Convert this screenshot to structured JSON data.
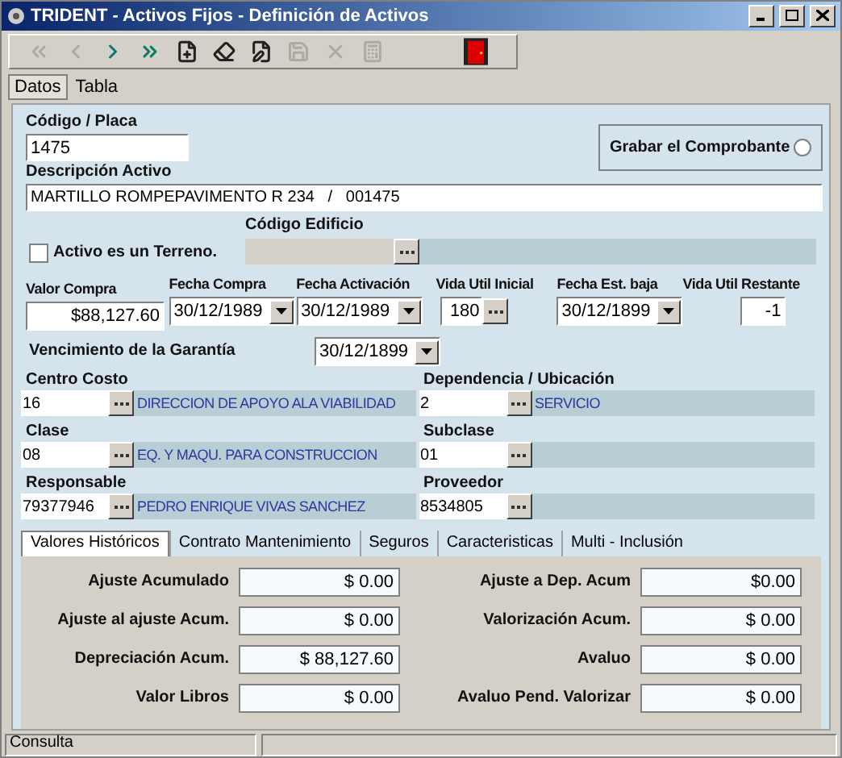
{
  "window": {
    "title": "TRIDENT - Activos Fijos - Definición de Activos"
  },
  "toolbar": [
    {
      "kind": "first",
      "disabled": true
    },
    {
      "kind": "previous",
      "disabled": true
    },
    {
      "kind": "next",
      "disabled": false
    },
    {
      "kind": "last",
      "disabled": false
    },
    {
      "kind": "new",
      "disabled": false
    },
    {
      "kind": "erase",
      "disabled": false
    },
    {
      "kind": "edit",
      "disabled": false
    },
    {
      "kind": "save",
      "disabled": true
    },
    {
      "kind": "delete",
      "disabled": true
    },
    {
      "kind": "calculator",
      "disabled": true
    },
    {
      "kind": "exit",
      "disabled": false
    }
  ],
  "view_tabs": [
    {
      "label": "Datos",
      "selected": true
    },
    {
      "label": "Tabla",
      "selected": false
    }
  ],
  "codigo": {
    "label": "Código / Placa",
    "value": "1475"
  },
  "grabar": {
    "label": "Grabar el Comprobante",
    "selected": false
  },
  "descripcion": {
    "label": "Descripción Activo",
    "value": "MARTILLO ROMPEPAVIMENTO R 234   /   001475"
  },
  "terreno": {
    "label": "Activo es un Terreno.",
    "checked": false
  },
  "codigo_edificio": {
    "label": "Código Edificio",
    "disabled": true
  },
  "purchase_fields": [
    {
      "kind": "amount",
      "label": "Valor Compra",
      "value": "$88,127.60"
    },
    {
      "kind": "date",
      "label": "Fecha Compra",
      "value": "30/12/1989"
    },
    {
      "kind": "date",
      "label": "Fecha Activación",
      "value": "30/12/1989"
    },
    {
      "kind": "lookup",
      "label": "Vida Util Inicial",
      "value": "180"
    },
    {
      "kind": "date",
      "label": "Fecha Est. baja",
      "value": "30/12/1899"
    },
    {
      "kind": "number",
      "label": "Vida Util Restante",
      "value": "-1"
    }
  ],
  "garantia": {
    "label": "Vencimiento de  la Garantía",
    "value": "30/12/1899"
  },
  "lookups": [
    {
      "label": "Centro Costo",
      "code": "16",
      "description": "DIRECCION DE APOYO ALA VIABILIDAD"
    },
    {
      "label": "Dependencia / Ubicación",
      "code": "2",
      "description": "SERVICIO"
    },
    {
      "label": "Clase",
      "code": "08",
      "description": "EQ. Y MAQU. PARA CONSTRUCCION"
    },
    {
      "label": "Subclase",
      "code": "01"
    },
    {
      "label": "Responsable",
      "code": "79377946",
      "description": "PEDRO ENRIQUE VIVAS SANCHEZ"
    },
    {
      "label": "Proveedor",
      "code": "8534805"
    }
  ],
  "detail_tabs": [
    {
      "label": "Valores Históricos",
      "selected": true
    },
    {
      "label": "Contrato Mantenimiento",
      "selected": false
    },
    {
      "label": "Seguros",
      "selected": false
    },
    {
      "label": "Caracteristicas",
      "selected": false
    },
    {
      "label": "Multi - Inclusión",
      "selected": false
    }
  ],
  "historicos": [
    {
      "label": "Ajuste Acumulado",
      "value": "$ 0.00"
    },
    {
      "label": "Ajuste a Dep. Acum",
      "value": "$0.00"
    },
    {
      "label": "Ajuste al ajuste Acum.",
      "value": "$ 0.00"
    },
    {
      "label": "Valorización Acum.",
      "value": "$ 0.00"
    },
    {
      "label": "Depreciación Acum.",
      "value": "$ 88,127.60"
    },
    {
      "label": "Avaluo",
      "value": "$ 0.00"
    },
    {
      "label": "Valor Libros",
      "value": "$ 0.00"
    },
    {
      "label": "Avaluo Pend. Valorizar",
      "value": "$ 0.00"
    }
  ],
  "status_bar": [
    "Consulta"
  ]
}
